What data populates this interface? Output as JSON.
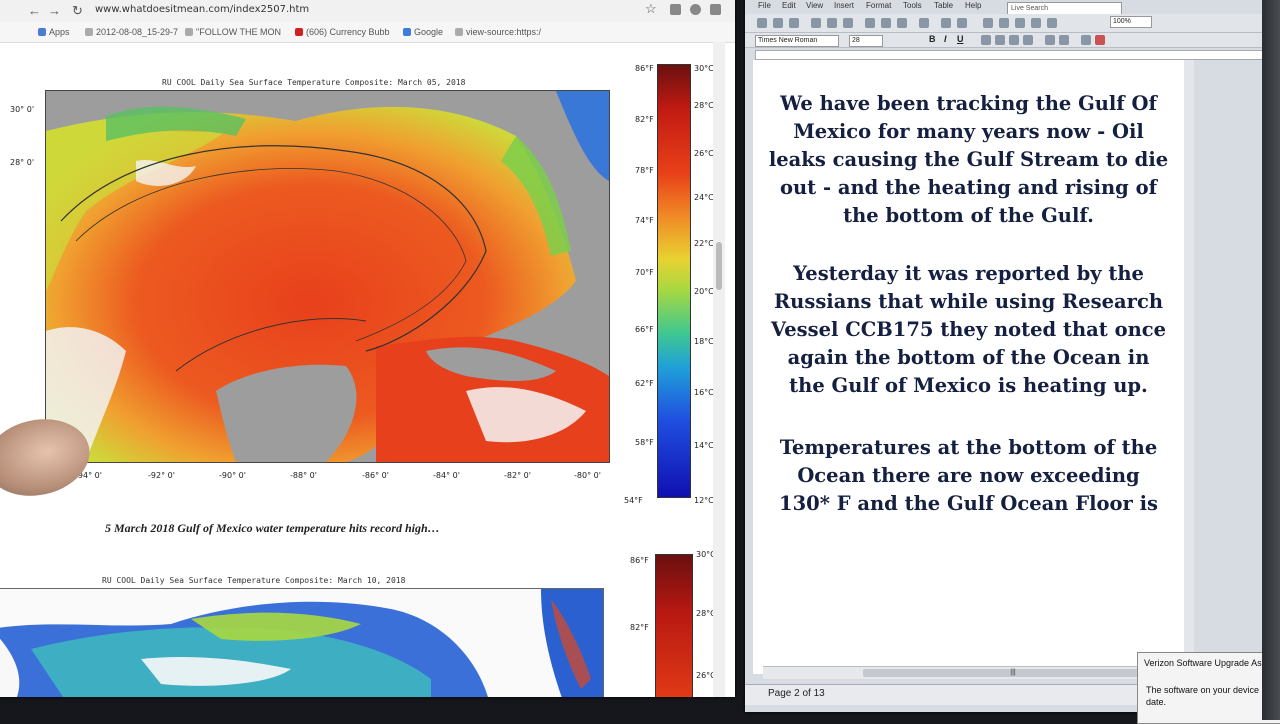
{
  "browser": {
    "url": "www.whatdoesitmean.com/index2507.htm",
    "bookmarks": [
      "Apps",
      "2012-08-08_15-29-7",
      "\"FOLLOW THE MON",
      "(606) Currency Bubb",
      "Google",
      "view-source:https:/"
    ],
    "map1": {
      "title": "RU COOL Daily Sea Surface Temperature Composite:  March 05, 2018",
      "lat_labels": [
        "30° 0'",
        "28° 0'"
      ],
      "lon_labels": [
        "-94° 0'",
        "-92° 0'",
        "-90° 0'",
        "-88° 0'",
        "-86° 0'",
        "-84° 0'",
        "-82° 0'",
        "-80° 0'"
      ],
      "colorbar_f": [
        "86°F",
        "82°F",
        "78°F",
        "74°F",
        "70°F",
        "66°F",
        "62°F",
        "58°F",
        "54°F"
      ],
      "colorbar_c": [
        "30°C",
        "28°C",
        "26°C",
        "24°C",
        "22°C",
        "20°C",
        "18°C",
        "16°C",
        "14°C",
        "12°C"
      ]
    },
    "caption": "5 March 2018 Gulf of Mexico water temperature hits record high…",
    "map2": {
      "title": "RU COOL Daily Sea Surface Temperature Composite:  March 10, 2018",
      "colorbar_f": [
        "86°F",
        "82°F"
      ],
      "colorbar_c": [
        "30°C",
        "28°C",
        "26°C"
      ]
    }
  },
  "word": {
    "menu": [
      "File",
      "Edit",
      "View",
      "Insert",
      "Format",
      "Tools",
      "Table",
      "Help"
    ],
    "search_placeholder": "Live Search",
    "font_name": "Times New Roman",
    "font_size": "28",
    "zoom": "100%",
    "paragraphs": [
      [
        "We have been tracking the Gulf Of",
        "Mexico for many years now - Oil",
        "leaks causing the Gulf Stream to die",
        "out - and the heating and rising of",
        "the bottom of the Gulf."
      ],
      [
        "Yesterday it was reported by the",
        "Russians that while using Research",
        "Vessel CCB175 they noted that once",
        "again the bottom of the Ocean in",
        "the Gulf of Mexico is heating up."
      ],
      [
        "Temperatures at the bottom of the",
        "Ocean there are now exceeding",
        "130* F and the Gulf Ocean Floor is"
      ]
    ],
    "status": "Page 2 of 13"
  },
  "notification": {
    "title": "Verizon Software Upgrade Assi",
    "body_line1": "The software on your device is",
    "body_line2": "date."
  },
  "colors": {
    "doc_text": "#152040",
    "hot": "#e0401e",
    "land": "#9d9d9d"
  }
}
